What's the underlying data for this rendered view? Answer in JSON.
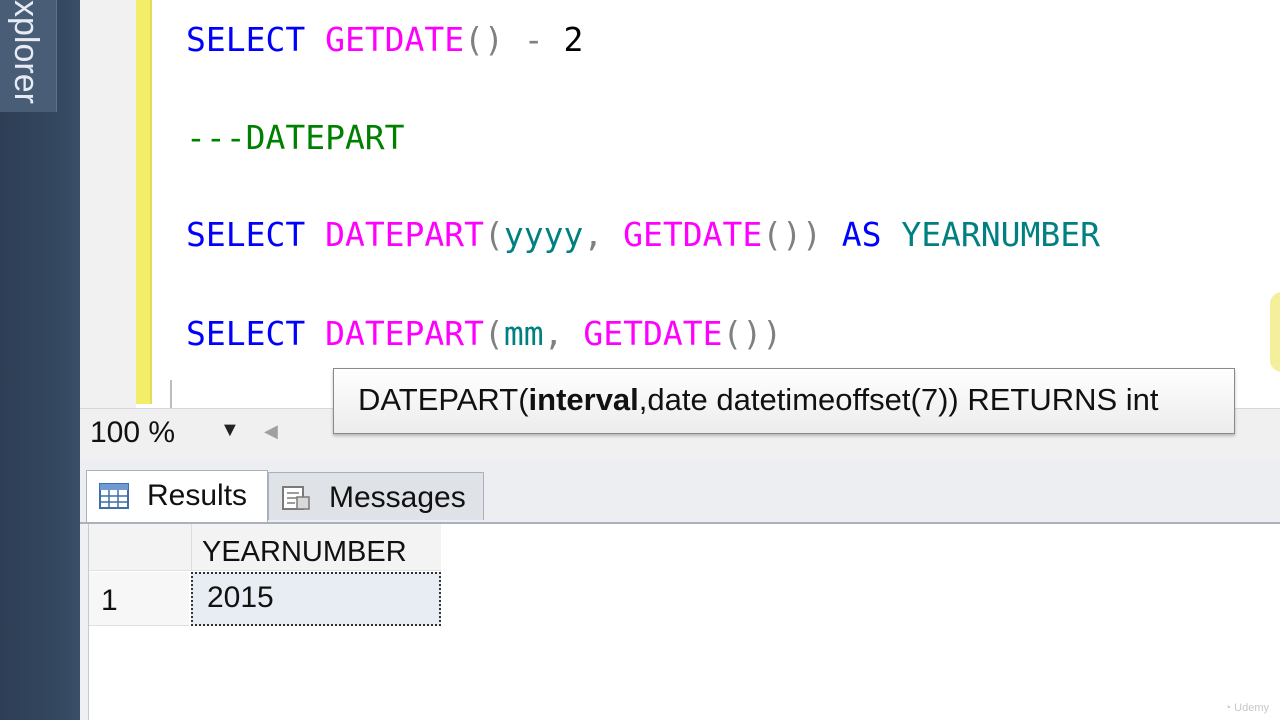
{
  "sidebar": {
    "label": "xplorer"
  },
  "editor": {
    "lines": [
      {
        "select": "SELECT ",
        "fn": "GETDATE",
        "paren": "()",
        "rest": " - ",
        "num": "2"
      },
      {
        "comment": "---DATEPART"
      },
      {
        "select": "SELECT ",
        "fn": "DATEPART",
        "open": "(",
        "arg1": "yyyy",
        "comma": ", ",
        "fn2": "GETDATE",
        "paren2": "())",
        "sp": " ",
        "as": "AS",
        "alias": " YEARNUMBER"
      },
      {
        "select": "SELECT ",
        "fn": "DATEPART",
        "open": "(",
        "arg1": "mm",
        "comma": ", ",
        "fn2": "GETDATE",
        "paren2": "())"
      }
    ]
  },
  "tooltip": {
    "prefix": "DATEPART(",
    "bold": "interval",
    "suffix": ",date datetimeoffset(7)) RETURNS int"
  },
  "zoom": {
    "value": "100 %"
  },
  "tabs": {
    "results": "Results",
    "messages": "Messages"
  },
  "grid": {
    "column": "YEARNUMBER",
    "row_number": "1",
    "value": "2015"
  },
  "icons": {
    "dropdown": "chevron-down-icon",
    "scroll_left": "arrow-left-icon",
    "results_tab": "grid-icon",
    "messages_tab": "messages-icon"
  },
  "colors": {
    "keyword": "#0000ff",
    "function": "#ff00ff",
    "comment": "#008000",
    "alias": "#008080",
    "operator": "#808080"
  }
}
